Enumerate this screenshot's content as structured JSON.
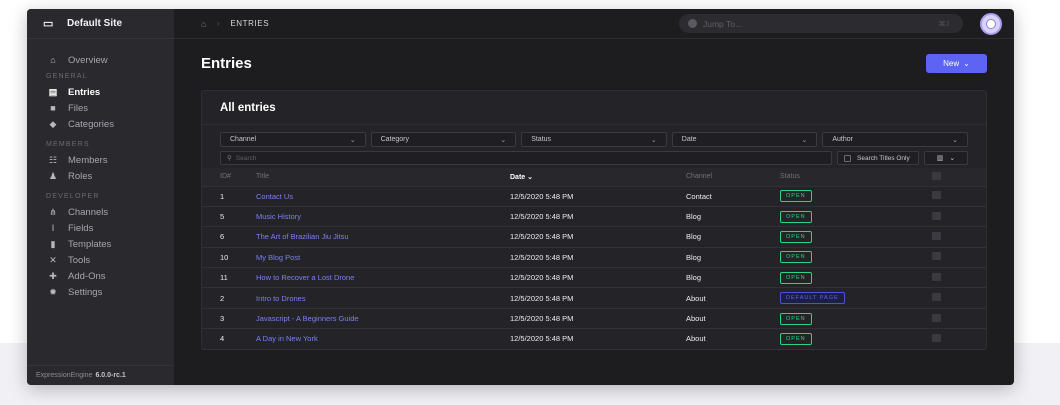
{
  "sidebar": {
    "site_name": "Default Site",
    "overview": "Overview",
    "sections": {
      "general": "GENERAL",
      "members": "MEMBERS",
      "developer": "DEVELOPER"
    },
    "general_items": [
      "Entries",
      "Files",
      "Categories"
    ],
    "member_items": [
      "Members",
      "Roles"
    ],
    "developer_items": [
      "Channels",
      "Fields",
      "Templates",
      "Tools",
      "Add-Ons",
      "Settings"
    ],
    "version_label": "ExpressionEngine",
    "version_number": "6.0.0-rc.1"
  },
  "topbar": {
    "breadcrumb": "ENTRIES",
    "jump_placeholder": "Jump To...",
    "jump_shortcut": "⌘J"
  },
  "page": {
    "title": "Entries",
    "new_button": "New"
  },
  "panel": {
    "title": "All entries",
    "filters": [
      "Channel",
      "Category",
      "Status",
      "Date",
      "Author"
    ],
    "search_placeholder": "Search",
    "search_titles_only": "Search Titles Only",
    "columns": {
      "id": "ID#",
      "title": "Title",
      "date": "Date",
      "channel": "Channel",
      "status": "Status"
    },
    "rows": [
      {
        "id": "1",
        "title": "Contact Us",
        "date": "12/5/2020 5:48 PM",
        "channel": "Contact",
        "status": "OPEN"
      },
      {
        "id": "5",
        "title": "Music History",
        "date": "12/5/2020 5:48 PM",
        "channel": "Blog",
        "status": "OPEN"
      },
      {
        "id": "6",
        "title": "The Art of Brazilian Jiu Jitsu",
        "date": "12/5/2020 5:48 PM",
        "channel": "Blog",
        "status": "OPEN"
      },
      {
        "id": "10",
        "title": "My Blog Post",
        "date": "12/5/2020 5:48 PM",
        "channel": "Blog",
        "status": "OPEN"
      },
      {
        "id": "11",
        "title": "How to Recover a Lost Drone",
        "date": "12/5/2020 5:48 PM",
        "channel": "Blog",
        "status": "OPEN"
      },
      {
        "id": "2",
        "title": "Intro to Drones",
        "date": "12/5/2020 5:48 PM",
        "channel": "About",
        "status": "DEFAULT PAGE"
      },
      {
        "id": "3",
        "title": "Javascript - A Beginners Guide",
        "date": "12/5/2020 5:48 PM",
        "channel": "About",
        "status": "OPEN"
      },
      {
        "id": "4",
        "title": "A Day in New York",
        "date": "12/5/2020 5:48 PM",
        "channel": "About",
        "status": "OPEN"
      }
    ]
  },
  "colors": {
    "accent": "#5d63f2",
    "open_status": "#27d67f",
    "default_page_status": "#5b63f0",
    "link": "#7d7ff2"
  }
}
